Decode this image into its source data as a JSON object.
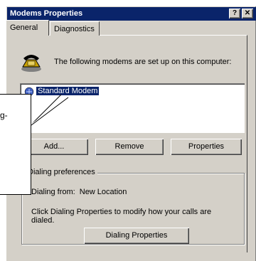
{
  "window": {
    "title": "Modems Properties",
    "help_button": "?",
    "close_button": "✕"
  },
  "tabs": [
    {
      "label": "General",
      "active": true
    },
    {
      "label": "Diagnostics",
      "active": false
    }
  ],
  "intro_text": "The following modems are set up on this computer:",
  "modem_list": [
    {
      "label": "Standard Modem",
      "selected": true,
      "icon": "modem-icon"
    }
  ],
  "buttons": {
    "add": "Add...",
    "remove": "Remove",
    "properties": "Properties",
    "dialing_properties": "Dialing Properties"
  },
  "dialing_preferences": {
    "legend": "Dialing preferences",
    "dialing_from_label": "Dialing from:",
    "dialing_from_value": "New Location",
    "note": "Click Dialing Properties to modify how your calls are dialed."
  },
  "callout": {
    "text": "g-"
  },
  "colors": {
    "titlebar": "#0a246a",
    "face": "#d4d0c8",
    "selection": "#0a246a"
  }
}
